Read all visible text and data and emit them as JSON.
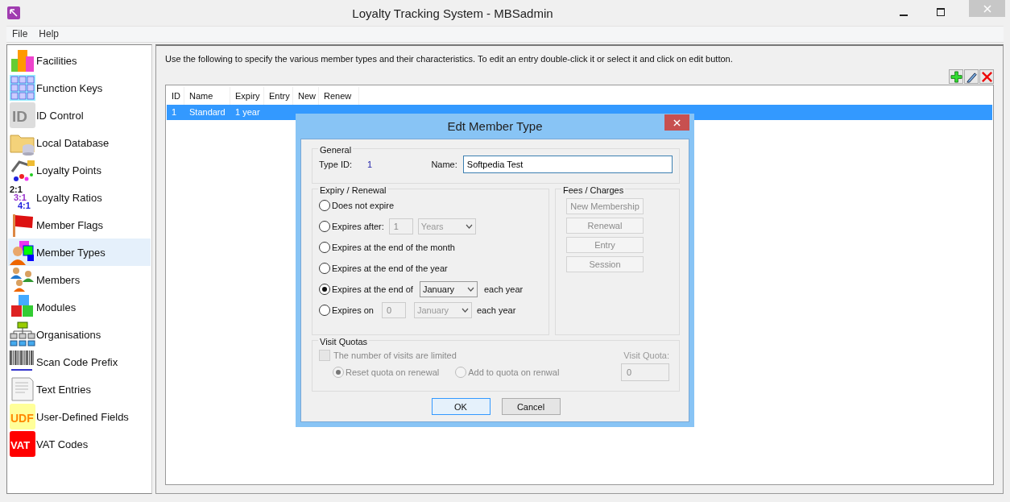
{
  "window": {
    "title": "Loyalty Tracking System - MBSadmin"
  },
  "menu": [
    {
      "label": "File"
    },
    {
      "label": "Help"
    }
  ],
  "sidebar": {
    "items": [
      {
        "label": "Facilities",
        "selected": false
      },
      {
        "label": "Function Keys",
        "selected": false
      },
      {
        "label": "ID Control",
        "selected": false,
        "icon_text": "ID"
      },
      {
        "label": "Local Database",
        "selected": false
      },
      {
        "label": "Loyalty Points",
        "selected": false
      },
      {
        "label": "Loyalty Ratios",
        "selected": false,
        "icon_text": [
          "2:1",
          "3:1",
          "4:1"
        ]
      },
      {
        "label": "Member Flags",
        "selected": false
      },
      {
        "label": "Member Types",
        "selected": true
      },
      {
        "label": "Members",
        "selected": false
      },
      {
        "label": "Modules",
        "selected": false
      },
      {
        "label": "Organisations",
        "selected": false
      },
      {
        "label": "Scan Code Prefix",
        "selected": false
      },
      {
        "label": "Text Entries",
        "selected": false
      },
      {
        "label": "User-Defined Fields",
        "selected": false,
        "icon_text": "UDF"
      },
      {
        "label": "VAT Codes",
        "selected": false,
        "icon_text": "VAT"
      }
    ]
  },
  "main": {
    "instructions": "Use the following to specify the various member types and their characteristics. To edit an entry double-click it or select it and click on edit button.",
    "table": {
      "columns": [
        "ID",
        "Name",
        "Expiry",
        "Entry",
        "New",
        "Renew"
      ],
      "rows": [
        {
          "cells": [
            "1",
            "Standard",
            "1 year",
            "",
            "",
            ""
          ],
          "selected": true
        }
      ]
    }
  },
  "dialog": {
    "title": "Edt Member Type",
    "general": {
      "legend": "General",
      "type_id_label": "Type ID:",
      "type_id": "1",
      "name_label": "Name:",
      "name_value": "Softpedia Test"
    },
    "expiry": {
      "legend": "Expiry / Renewal",
      "options": [
        {
          "kind": "plain",
          "label": "Does not expire",
          "selected": false
        },
        {
          "kind": "after",
          "label": "Expires after:",
          "selected": false,
          "number": "1",
          "unit": "Years",
          "disabled": true
        },
        {
          "kind": "plain",
          "label": "Expires at the end of the month",
          "selected": false
        },
        {
          "kind": "plain",
          "label": "Expires at the end of the year",
          "selected": false
        },
        {
          "kind": "month",
          "label": "Expires at the end of",
          "selected": true,
          "month": "January",
          "suffix": "each year",
          "disabled": false
        },
        {
          "kind": "date",
          "label": "Expires on",
          "selected": false,
          "number": "0",
          "month": "January",
          "suffix": "each year",
          "disabled": true
        }
      ]
    },
    "fees": {
      "legend": "Fees / Charges",
      "buttons": [
        {
          "label": "New Membership",
          "disabled": true
        },
        {
          "label": "Renewal",
          "disabled": true
        },
        {
          "label": "Entry",
          "disabled": true
        },
        {
          "label": "Session",
          "disabled": true
        }
      ]
    },
    "quotas": {
      "legend": "Visit Quotas",
      "limit": {
        "label": "The number of visits are limited",
        "checked": false,
        "disabled": true
      },
      "modes": [
        {
          "label": "Reset quota on renewal",
          "selected": true,
          "disabled": true
        },
        {
          "label": "Add to quota on renwal",
          "selected": false,
          "disabled": true
        }
      ],
      "quota_label": "Visit Quota:",
      "quota_value": "0",
      "quota_disabled": true
    },
    "buttons": [
      {
        "label": "OK",
        "default": true
      },
      {
        "label": "Cancel",
        "default": false
      }
    ]
  }
}
